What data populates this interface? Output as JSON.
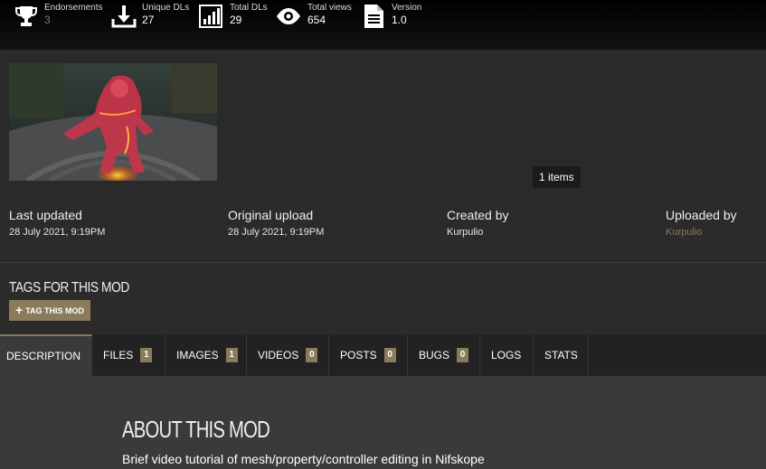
{
  "stats": {
    "endorsements": {
      "label": "Endorsements",
      "value": "3",
      "icon": "trophy-icon"
    },
    "unique_dls": {
      "label": "Unique DLs",
      "value": "27",
      "icon": "download-icon"
    },
    "total_dls": {
      "label": "Total DLs",
      "value": "29",
      "icon": "bar-chart-icon"
    },
    "total_views": {
      "label": "Total views",
      "value": "654",
      "icon": "eye-icon"
    },
    "version": {
      "label": "Version",
      "value": "1.0",
      "icon": "document-icon"
    }
  },
  "gallery": {
    "items_count": "1 items"
  },
  "meta": {
    "last_updated": {
      "label": "Last updated",
      "value": "28 July 2021,  9:19PM"
    },
    "original_upload": {
      "label": "Original upload",
      "value": "28 July 2021,  9:19PM"
    },
    "created_by": {
      "label": "Created by",
      "value": "Kurpulio"
    },
    "uploaded_by": {
      "label": "Uploaded by",
      "value": "Kurpulio"
    }
  },
  "tags": {
    "title": "TAGS FOR THIS MOD",
    "button_label": "TAG THIS MOD"
  },
  "tabs": [
    {
      "label": "DESCRIPTION"
    },
    {
      "label": "FILES",
      "count": "1"
    },
    {
      "label": "IMAGES",
      "count": "1"
    },
    {
      "label": "VIDEOS",
      "count": "0"
    },
    {
      "label": "POSTS",
      "count": "0"
    },
    {
      "label": "BUGS",
      "count": "0"
    },
    {
      "label": "LOGS"
    },
    {
      "label": "STATS"
    }
  ],
  "about": {
    "title": "ABOUT THIS MOD",
    "description": "Brief video tutorial of mesh/property/controller editing in Nifskope"
  },
  "colors": {
    "accent": "#8a7b5a",
    "background": "#2d2d2d",
    "stats_bar": "#000000"
  }
}
